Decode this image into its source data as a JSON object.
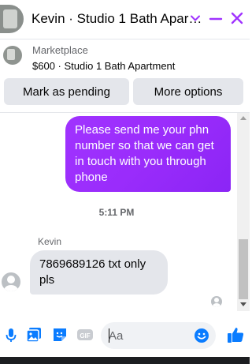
{
  "header": {
    "title": "Kevin · Studio 1 Bath Apart...",
    "chevron_icon": "chevron-down-icon",
    "minimize_icon": "minimize-icon",
    "close_icon": "close-icon"
  },
  "item": {
    "label": "Marketplace",
    "title": "$600 · Studio 1 Bath Apartment"
  },
  "actions": {
    "pending_label": "Mark as pending",
    "more_label": "More options"
  },
  "messages": {
    "outgoing": "Please send me your phn number so that we can get in touch with you through phone",
    "timestamp": "5:11 PM",
    "sender_name": "Kevin",
    "incoming": "7869689126 txt only pls"
  },
  "composer": {
    "placeholder": "Aa",
    "icons": [
      "microphone-icon",
      "photo-icon",
      "sticker-icon",
      "gif-icon",
      "emoji-icon",
      "thumbs-up-icon"
    ]
  },
  "colors": {
    "accent": "#a033ff",
    "outgoing_bubble": "#9a2cfb",
    "incoming_bubble": "#e4e6eb",
    "icon_blue": "#0a7cff",
    "close_purple": "#a033ff"
  }
}
